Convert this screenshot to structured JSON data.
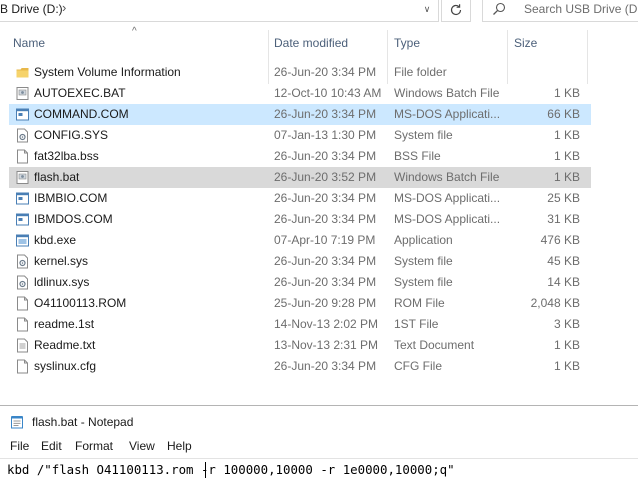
{
  "explorer": {
    "address": "B Drive (D:)",
    "search_placeholder": "Search USB Drive (D:)"
  },
  "columns": {
    "name": "Name",
    "date": "Date modified",
    "type": "Type",
    "size": "Size"
  },
  "files": [
    {
      "name": "System Volume Information",
      "date": "26-Jun-20 3:34 PM",
      "type": "File folder",
      "size": "",
      "icon": "folder-icon",
      "state": "normal"
    },
    {
      "name": "AUTOEXEC.BAT",
      "date": "12-Oct-10 10:43 AM",
      "type": "Windows Batch File",
      "size": "1 KB",
      "icon": "batch-file-icon",
      "state": "normal"
    },
    {
      "name": "COMMAND.COM",
      "date": "26-Jun-20 3:34 PM",
      "type": "MS-DOS Applicati...",
      "size": "66 KB",
      "icon": "dos-app-icon",
      "state": "selected"
    },
    {
      "name": "CONFIG.SYS",
      "date": "07-Jan-13 1:30 PM",
      "type": "System file",
      "size": "1 KB",
      "icon": "system-file-icon",
      "state": "normal"
    },
    {
      "name": "fat32lba.bss",
      "date": "26-Jun-20 3:34 PM",
      "type": "BSS File",
      "size": "1 KB",
      "icon": "generic-file-icon",
      "state": "normal"
    },
    {
      "name": "flash.bat",
      "date": "26-Jun-20 3:52 PM",
      "type": "Windows Batch File",
      "size": "1 KB",
      "icon": "batch-file-icon",
      "state": "inactive-selected"
    },
    {
      "name": "IBMBIO.COM",
      "date": "26-Jun-20 3:34 PM",
      "type": "MS-DOS Applicati...",
      "size": "25 KB",
      "icon": "dos-app-icon",
      "state": "normal"
    },
    {
      "name": "IBMDOS.COM",
      "date": "26-Jun-20 3:34 PM",
      "type": "MS-DOS Applicati...",
      "size": "31 KB",
      "icon": "dos-app-icon",
      "state": "normal"
    },
    {
      "name": "kbd.exe",
      "date": "07-Apr-10 7:19 PM",
      "type": "Application",
      "size": "476 KB",
      "icon": "exe-icon",
      "state": "normal"
    },
    {
      "name": "kernel.sys",
      "date": "26-Jun-20 3:34 PM",
      "type": "System file",
      "size": "45 KB",
      "icon": "system-file-icon",
      "state": "normal"
    },
    {
      "name": "ldlinux.sys",
      "date": "26-Jun-20 3:34 PM",
      "type": "System file",
      "size": "14 KB",
      "icon": "system-file-icon",
      "state": "normal"
    },
    {
      "name": "O41100113.ROM",
      "date": "25-Jun-20 9:28 PM",
      "type": "ROM File",
      "size": "2,048 KB",
      "icon": "generic-file-icon",
      "state": "normal"
    },
    {
      "name": "readme.1st",
      "date": "14-Nov-13 2:02 PM",
      "type": "1ST File",
      "size": "3 KB",
      "icon": "generic-file-icon",
      "state": "normal"
    },
    {
      "name": "Readme.txt",
      "date": "13-Nov-13 2:31 PM",
      "type": "Text Document",
      "size": "1 KB",
      "icon": "text-file-icon",
      "state": "normal"
    },
    {
      "name": "syslinux.cfg",
      "date": "26-Jun-20 3:34 PM",
      "type": "CFG File",
      "size": "1 KB",
      "icon": "generic-file-icon",
      "state": "normal"
    }
  ],
  "notepad": {
    "title": "flash.bat - Notepad",
    "menu": [
      "File",
      "Edit",
      "Format",
      "View",
      "Help"
    ],
    "content_before_caret": "kbd /\"flash O41100113.rom",
    "content_after_caret": " -r 100000,10000 -r 1e0000,10000;q\""
  },
  "colors": {
    "selected_row": "#cce8ff",
    "inactive_selected_row": "#d9d9d9",
    "header_text": "#4c607a",
    "folder": "#f2c55c"
  }
}
